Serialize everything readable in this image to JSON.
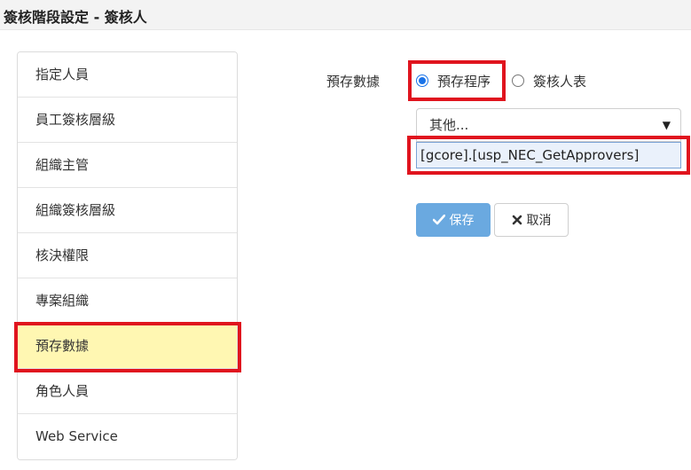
{
  "title": "簽核階段設定 - 簽核人",
  "menu": {
    "items": [
      {
        "label": "指定人員"
      },
      {
        "label": "員工簽核層級"
      },
      {
        "label": "組織主管"
      },
      {
        "label": "組織簽核層級"
      },
      {
        "label": "核決權限"
      },
      {
        "label": "專案組織"
      },
      {
        "label": "預存數據",
        "active": true
      },
      {
        "label": "角色人員"
      },
      {
        "label": "Web Service"
      }
    ]
  },
  "form": {
    "field_label": "預存數據",
    "radio_options": [
      {
        "label": "預存程序",
        "checked": true
      },
      {
        "label": "簽核人表",
        "checked": false
      }
    ],
    "select_value": "其他...",
    "procedure_value": "[gcore].[usp_NEC_GetApprovers]"
  },
  "buttons": {
    "save": "保存",
    "cancel": "取消"
  },
  "icons": {
    "save": "check-icon",
    "cancel": "x-icon",
    "select": "caret-down-icon"
  },
  "colors": {
    "highlight": "#e0141e",
    "active_item": "#fff7b2",
    "primary": "#6aa9e0",
    "radio": "#1a73e8"
  }
}
